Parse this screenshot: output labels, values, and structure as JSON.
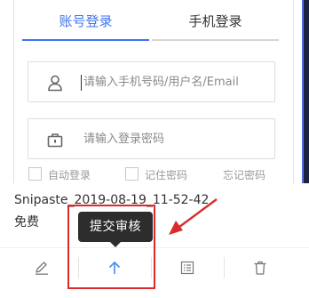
{
  "login_preview": {
    "tabs": [
      {
        "label": "账号登录",
        "active": true
      },
      {
        "label": "手机登录",
        "active": false
      }
    ],
    "username_placeholder": "请输入手机号码/用户名/Email",
    "password_placeholder": "请输入登录密码",
    "auto_login_label": "自动登录",
    "remember_password_label": "记住密码",
    "forgot_password_label": "忘记密码"
  },
  "card": {
    "file_name": "Snipaste_2019-08-19_11-52-42",
    "price": "免费"
  },
  "actions": {
    "items": [
      {
        "name": "edit",
        "icon": "pencil-icon"
      },
      {
        "name": "submit-review",
        "icon": "upload-arrow-icon"
      },
      {
        "name": "details",
        "icon": "list-icon"
      },
      {
        "name": "delete",
        "icon": "trash-icon"
      }
    ]
  },
  "tooltip": {
    "text": "提交审核"
  },
  "colors": {
    "accent": "#3e74f0",
    "tooltip_bg": "#2d2d2d",
    "annotation_red": "#d92b2b",
    "submit_icon": "#3e8ef0"
  }
}
